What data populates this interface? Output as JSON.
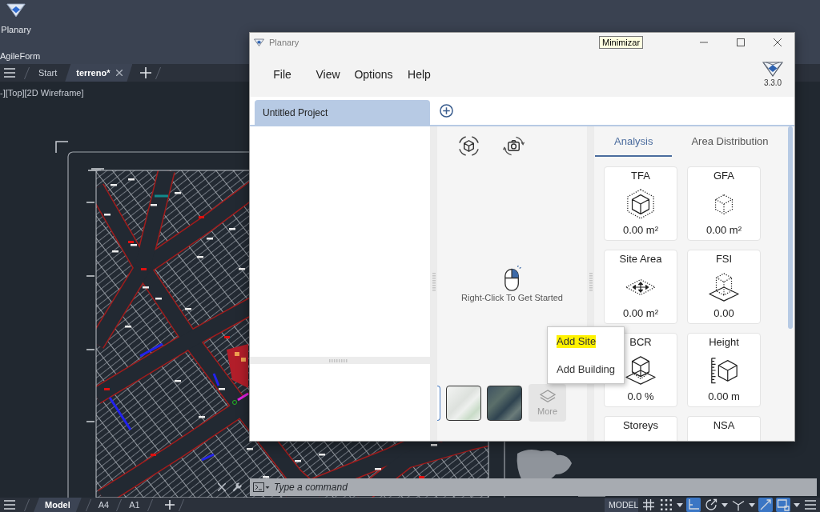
{
  "desktop": {
    "launcher_label": "Planary",
    "ribbon_label": "AgileForm"
  },
  "cad": {
    "file_tabs": [
      {
        "label": "Start",
        "selected": false
      },
      {
        "label": "terreno*",
        "selected": true
      }
    ],
    "viewport_label": "-][Top][2D Wireframe]",
    "command_line": {
      "placeholder": "Type a command"
    },
    "layout_tabs": [
      {
        "label": "Model",
        "selected": true
      },
      {
        "label": "A4",
        "selected": false
      },
      {
        "label": "A1",
        "selected": false
      }
    ],
    "status_bar": {
      "model_button": "MODEL",
      "toggles": [
        {
          "kind": "grid",
          "on": false,
          "dropdown": false
        },
        {
          "kind": "snap",
          "on": false,
          "dropdown": true
        },
        {
          "kind": "ortho",
          "on": true,
          "dropdown": false
        },
        {
          "kind": "polar",
          "on": false,
          "dropdown": true
        },
        {
          "kind": "isometric",
          "on": false,
          "dropdown": true
        },
        {
          "kind": "dynamic",
          "on": true,
          "dropdown": false
        },
        {
          "kind": "selection",
          "on": true,
          "dropdown": true
        },
        {
          "kind": "customize",
          "on": false,
          "dropdown": false
        }
      ]
    }
  },
  "planary": {
    "window": {
      "title": "Planary",
      "tooltip": "Minimizar"
    },
    "menu": [
      "File",
      "View",
      "Options",
      "Help"
    ],
    "version": "3.3.0",
    "project_tabs": [
      {
        "label": "Untitled Project",
        "selected": true
      }
    ],
    "viewer": {
      "hint": "Right-Click To Get Started",
      "map_styles": [
        {
          "kind": "edge",
          "selected": true
        },
        {
          "kind": "light",
          "selected": false
        },
        {
          "kind": "satellite",
          "selected": false
        }
      ],
      "more_button": "More"
    },
    "context_menu": [
      {
        "label": "Add Site",
        "highlighted": true
      },
      {
        "label": "Add Building",
        "highlighted": false
      }
    ],
    "analysis": {
      "tabs": [
        {
          "label": "Analysis",
          "selected": true
        },
        {
          "label": "Area Distribution",
          "selected": false
        }
      ],
      "cards": [
        {
          "title": "TFA",
          "kind": "volume",
          "value": "0.00 m²"
        },
        {
          "title": "GFA",
          "kind": "gross",
          "value": "0.00 m²"
        },
        {
          "title": "Site Area",
          "kind": "site",
          "value": "0.00 m²"
        },
        {
          "title": "FSI",
          "kind": "ratio",
          "value": "0.00"
        },
        {
          "title": "BCR",
          "kind": "coverage",
          "value": "0.0 %"
        },
        {
          "title": "Height",
          "kind": "height",
          "value": "0.00 m"
        },
        {
          "title": "Storeys"
        },
        {
          "title": "NSA"
        }
      ]
    }
  }
}
